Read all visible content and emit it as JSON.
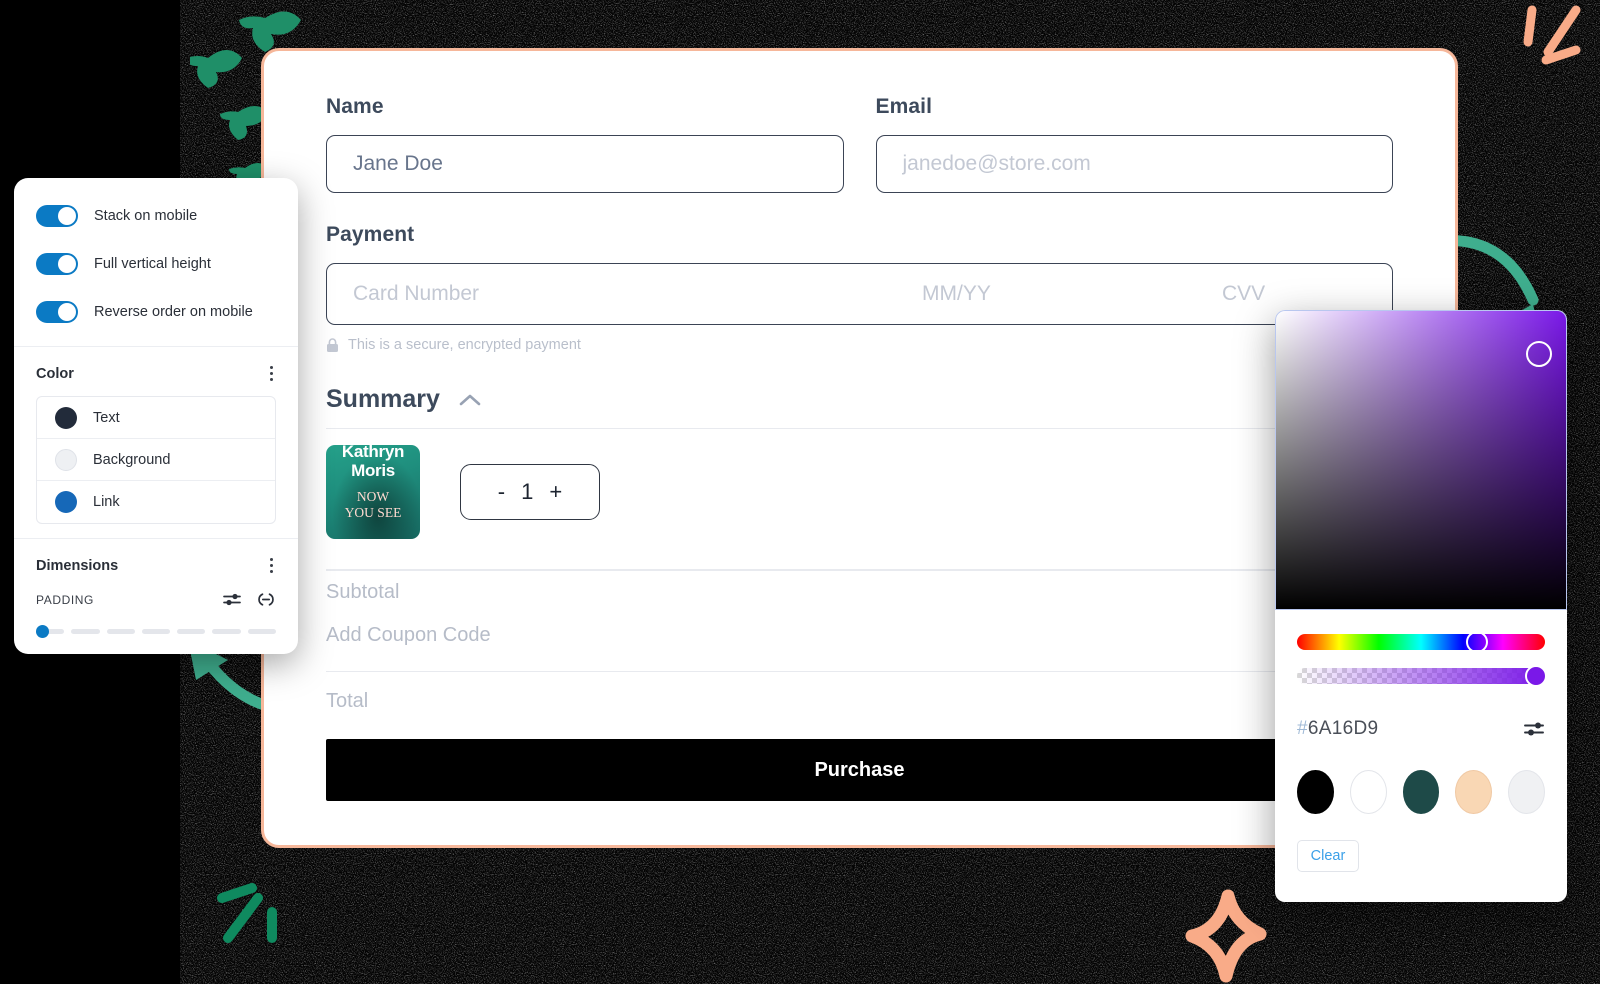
{
  "settings_panel": {
    "toggles": [
      {
        "label": "Stack on mobile",
        "on": true
      },
      {
        "label": "Full vertical height",
        "on": true
      },
      {
        "label": "Reverse order on mobile",
        "on": true
      }
    ],
    "color_section": {
      "title": "Color",
      "menu_icon": "kebab-menu-icon",
      "items": [
        {
          "label": "Text",
          "color": "#222b3a"
        },
        {
          "label": "Background",
          "color": "#eef0f3"
        },
        {
          "label": "Link",
          "color": "#1668b8"
        }
      ]
    },
    "dimensions_section": {
      "title": "Dimensions",
      "menu_icon": "kebab-menu-icon",
      "padding_label": "PADDING",
      "sliders_icon": "sliders-icon",
      "link_icon": "link-icon",
      "padding_value_percent": 0
    }
  },
  "checkout": {
    "name": {
      "label": "Name",
      "value": "Jane Doe",
      "placeholder": "Jane Doe"
    },
    "email": {
      "label": "Email",
      "value": "",
      "placeholder": "janedoe@store.com"
    },
    "payment": {
      "label": "Payment",
      "card_number_placeholder": "Card Number",
      "expiry_placeholder": "MM/YY",
      "cvv_placeholder": "CVV",
      "secure_note": "This is a secure, encrypted payment",
      "lock_icon": "lock-icon"
    },
    "summary": {
      "title": "Summary",
      "collapse_icon": "chevron-up-icon",
      "product": {
        "artist": "Kathryn Moris",
        "title_line1": "NOW",
        "title_line2": "YOU SEE"
      },
      "quantity": "1",
      "decrement_label": "-",
      "increment_label": "+",
      "subtotal_label": "Subtotal",
      "subtotal_value": "",
      "coupon_label": "Add Coupon Code",
      "total_label": "Total",
      "total_value": ""
    },
    "purchase_label": "Purchase"
  },
  "color_picker": {
    "current_color": "#6A16D9",
    "hex_display_hash": "#",
    "hex_display_value": "6A16D9",
    "sliders_icon": "sliders-icon",
    "presets": [
      "#000000",
      "#ffffff",
      "#1e4a48",
      "#f9d7b4",
      "#f0f1f3"
    ],
    "clear_label": "Clear"
  },
  "theme": {
    "accent_blue": "#0b7ac4",
    "card_border": "#f6b79a",
    "deco_green": "#3fae8e",
    "deco_peach": "#f9ab88",
    "purchase_bg": "#000000"
  }
}
